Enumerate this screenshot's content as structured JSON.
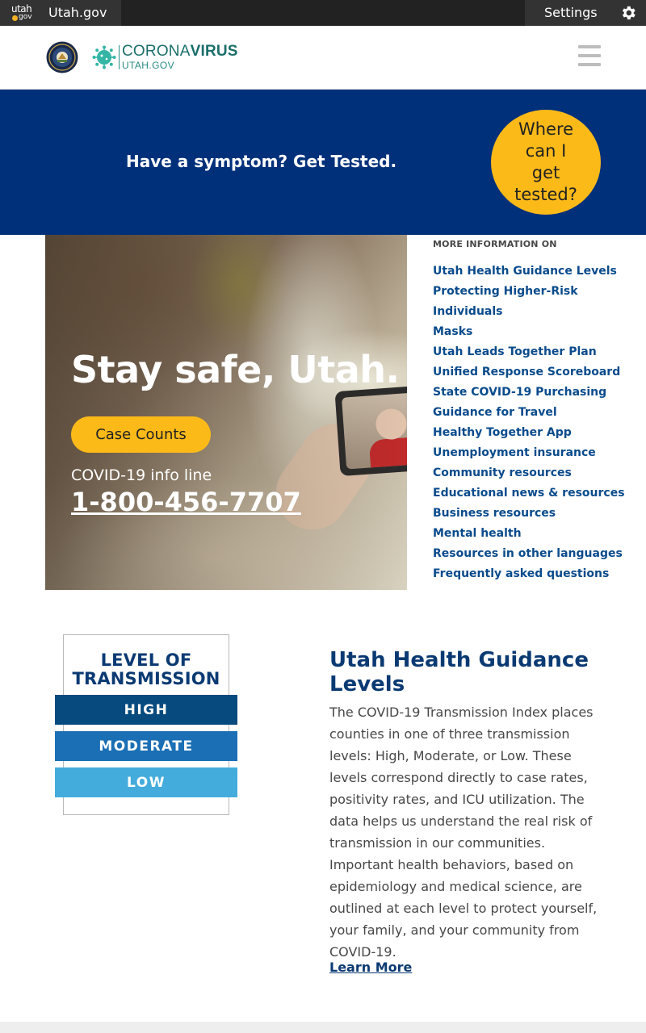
{
  "gov_bar": {
    "logo_word": "utah",
    "logo_sub": "gov",
    "site_label": "Utah.gov",
    "settings_label": "Settings",
    "settings_icon": "gear-icon"
  },
  "header": {
    "brand_light": "CORONA",
    "brand_bold": "VIRUS",
    "brand_sub": "UTAH.GOV",
    "seal_icon": "state-seal-icon",
    "virus_icon": "virus-icon",
    "menu_icon": "hamburger-menu-icon"
  },
  "banner": {
    "text": "Have a symptom? Get Tested.",
    "cta": "Where can I get tested?",
    "background": "#00307a",
    "accent": "#fcba19"
  },
  "hero": {
    "title": "Stay safe, Utah.",
    "button": "Case Counts",
    "info_label": "COVID-19 info line",
    "phone": "1-800-456-7707"
  },
  "more_info": {
    "heading": "MORE INFORMATION ON",
    "links": [
      "Utah Health Guidance Levels",
      "Protecting Higher-Risk",
      "Individuals",
      "Masks",
      "Utah Leads Together Plan",
      "Unified Response Scoreboard",
      "State COVID-19 Purchasing",
      "Guidance for Travel",
      "Healthy Together App",
      "Unemployment insurance",
      "Community resources",
      "Educational news & resources",
      "Business resources",
      "Mental health",
      "Resources in other languages",
      "Frequently asked questions"
    ],
    "link_color": "#0a4b8c"
  },
  "guidance": {
    "graphic_title_1": "LEVEL OF",
    "graphic_title_2": "TRANSMISSION",
    "levels": [
      {
        "label": "HIGH",
        "color": "#064a7e"
      },
      {
        "label": "MODERATE",
        "color": "#1a6fb5"
      },
      {
        "label": "LOW",
        "color": "#44acdc"
      }
    ],
    "title": "Utah Health Guidance Levels",
    "body": "The COVID-19 Transmission Index places counties in one of three transmission levels: High, Moderate, or Low. These levels correspond directly to case rates, positivity rates, and ICU utilization. The data helps us understand the real risk of transmission in our communities. Important health behaviors, based on epidemiology and medical science, are outlined at each level to protect yourself, your family, and your community from COVID-19.",
    "learn_more": "Learn More"
  }
}
